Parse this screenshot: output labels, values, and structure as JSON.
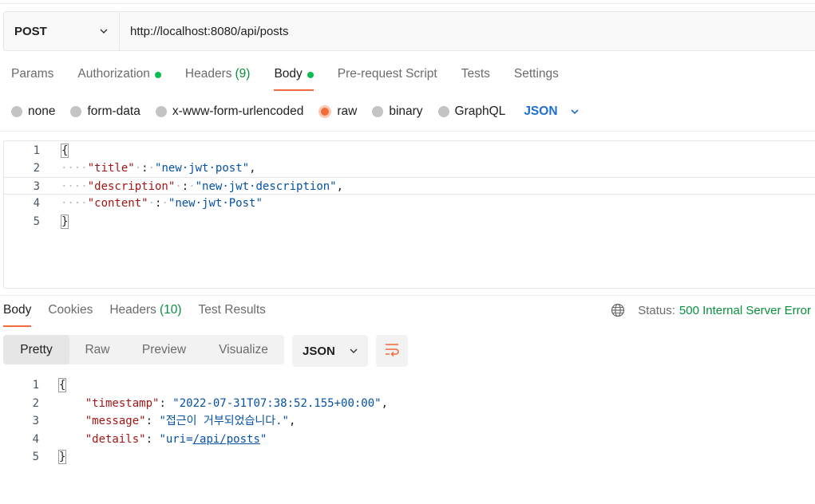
{
  "request": {
    "method": "POST",
    "url": "http://localhost:8080/api/posts",
    "tabs": [
      {
        "label": "Params"
      },
      {
        "label": "Authorization"
      },
      {
        "label": "Headers",
        "count": "(9)"
      },
      {
        "label": "Body"
      },
      {
        "label": "Pre-request Script"
      },
      {
        "label": "Tests"
      },
      {
        "label": "Settings"
      }
    ],
    "body_types": [
      "none",
      "form-data",
      "x-www-form-urlencoded",
      "raw",
      "binary",
      "GraphQL"
    ],
    "body_format": "JSON",
    "body_lines": {
      "n1": "1",
      "n2": "2",
      "n3": "3",
      "n4": "4",
      "n5": "5",
      "open": "{",
      "close": "}",
      "k1": "\"title\"",
      "v1": "\"new·jwt·post\"",
      "k2": "\"description\"",
      "v2": "\"new·jwt·description\"",
      "k3": "\"content\"",
      "v3": "\"new·jwt·Post\""
    }
  },
  "response": {
    "tabs": [
      {
        "label": "Body"
      },
      {
        "label": "Cookies"
      },
      {
        "label": "Headers",
        "count": "(10)"
      },
      {
        "label": "Test Results"
      }
    ],
    "status_label": "Status:",
    "status_value": "500 Internal Server Error",
    "views": [
      "Pretty",
      "Raw",
      "Preview",
      "Visualize"
    ],
    "format": "JSON",
    "lines": {
      "n1": "1",
      "n2": "2",
      "n3": "3",
      "n4": "4",
      "n5": "5",
      "open": "{",
      "close": "}",
      "k1": "\"timestamp\"",
      "v1": "\"2022-07-31T07:38:52.155+00:00\"",
      "k2": "\"message\"",
      "v2": "\"접근이 거부되었습니다.\"",
      "k3": "\"details\"",
      "v3_prefix": "\"uri=",
      "v3_link": "/api/posts",
      "v3_suffix": "\""
    }
  },
  "colors": {
    "accent": "#f26b3a",
    "success": "#0a8f3c",
    "link": "#1f6fd1"
  }
}
